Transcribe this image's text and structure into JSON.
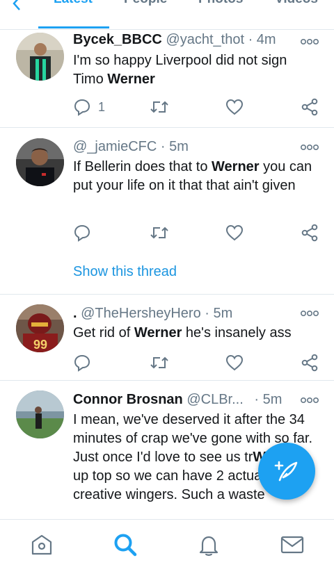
{
  "tabs": [
    {
      "label": "Latest",
      "active": true
    },
    {
      "label": "People",
      "active": false
    },
    {
      "label": "Photos",
      "active": false
    },
    {
      "label": "Videos",
      "active": false
    }
  ],
  "tweets": [
    {
      "name": "Bycek_BBCC",
      "handle": "@yacht_thot",
      "sep": "·",
      "time": "4m",
      "body_parts": [
        "I'm so happy Liverpool did not sign Timo ",
        "Werner",
        ""
      ],
      "reply_count": "1"
    },
    {
      "name": "",
      "handle": "@_jamieCFC",
      "sep": "·",
      "time": "5m",
      "body_parts": [
        "If Bellerin does that to ",
        "Werner",
        " you can put your life on it that that ain't given"
      ],
      "thread_link": "Show this thread"
    },
    {
      "name": ".",
      "handle": "@TheHersheyHero",
      "sep": "·",
      "time": "5m",
      "body_parts": [
        "Get rid of ",
        "Werner",
        " he's insanely ass"
      ]
    },
    {
      "name": "Connor Brosnan",
      "handle": "@CLBr...",
      "sep": "·",
      "time": "5m",
      "body_line1": "I mean, we've deserved it after the 34 minutes of crap we've gone with so far.",
      "body_line2_pre": "Just once I'd love to see us tr",
      "body_bold": "Werner",
      "body_line2_post": " up top so we can have 2 actual creative wingers. Such a waste"
    }
  ],
  "colors": {
    "accent": "#1da1f2",
    "link": "#1b95e0",
    "secondary_text": "#657786",
    "divider": "#e1e8ed"
  },
  "icons": {
    "reply": "reply-icon",
    "retweet": "retweet-icon",
    "like": "like-icon",
    "share": "share-icon",
    "more": "more-icon",
    "home": "home-icon",
    "search": "search-icon",
    "notifications": "bell-icon",
    "messages": "mail-icon",
    "compose": "compose-icon"
  },
  "nav": {
    "active": "search"
  }
}
